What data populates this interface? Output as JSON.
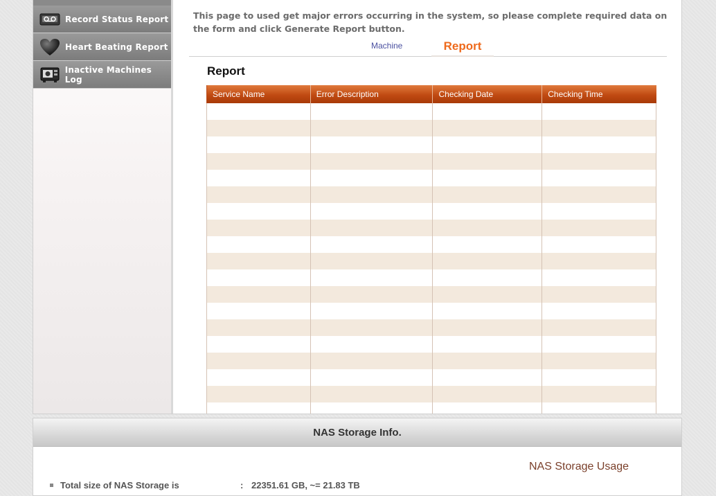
{
  "sidebar": {
    "items": [
      {
        "label": "Record Status Report",
        "icon": "tape-icon"
      },
      {
        "label": "Heart Beating Report",
        "icon": "heart-icon"
      },
      {
        "label": "Inactive Machines Log",
        "icon": "machine-icon"
      }
    ]
  },
  "main": {
    "intro": "This page to used get major errors occurring in the system, so please complete required data on the form and click Generate Report button.",
    "tabs": [
      {
        "label": "Machine",
        "active": false
      },
      {
        "label": "Report",
        "active": true
      }
    ],
    "section_title": "Report",
    "table": {
      "headers": [
        "Service Name",
        "Error Description",
        "Checking Date",
        "Checking Time"
      ],
      "rows": 19
    }
  },
  "nas": {
    "title": "NAS Storage Info.",
    "usage_label": "NAS Storage Usage",
    "total_label": "Total size of NAS Storage is",
    "separator": ":",
    "total_value": "22351.61 GB, ~= 21.83 TB"
  },
  "colors": {
    "accent": "#ee6a1c",
    "table_header": "#c04a12",
    "row_alt": "#f3e9dd",
    "link": "#4a50a0"
  }
}
